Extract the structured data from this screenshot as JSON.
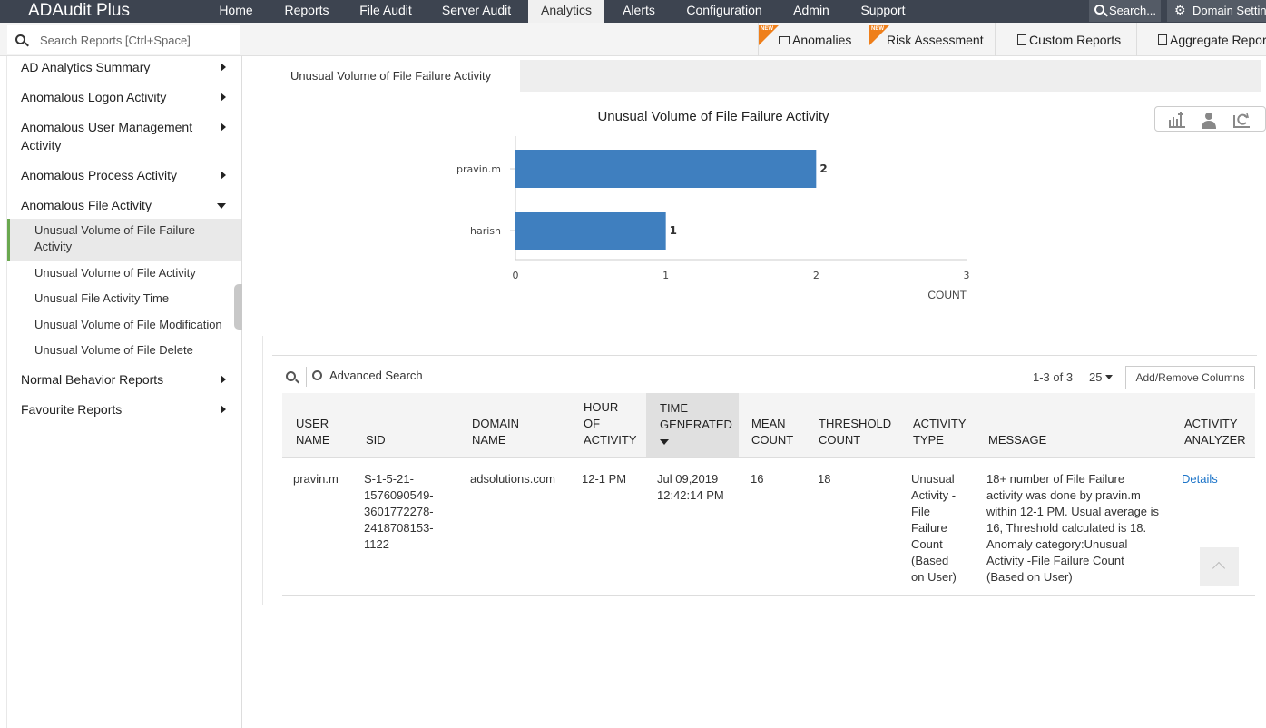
{
  "app": {
    "title": "ADAudit Plus"
  },
  "nav": {
    "items": [
      "Home",
      "Reports",
      "File Audit",
      "Server Audit",
      "Analytics",
      "Alerts",
      "Configuration",
      "Admin",
      "Support"
    ],
    "active": "Analytics",
    "search_label": "Search...",
    "domain_label": "Domain Settings"
  },
  "subbar": {
    "search_placeholder": "Search Reports [Ctrl+Space]",
    "new_badge": "NEW",
    "anomalies": "Anomalies",
    "risk_assessment": "Risk Assessment",
    "custom_reports": "Custom Reports",
    "aggregate_reports": "Aggregate Reports"
  },
  "sidebar": {
    "categories": [
      {
        "label": "AD Analytics Summary",
        "expanded": false
      },
      {
        "label": "Anomalous Logon Activity",
        "expanded": false
      },
      {
        "label": "Anomalous User Management Activity",
        "expanded": false
      },
      {
        "label": "Anomalous Process Activity",
        "expanded": false
      },
      {
        "label": "Anomalous File Activity",
        "expanded": true
      },
      {
        "label": "Normal Behavior Reports",
        "expanded": false
      },
      {
        "label": "Favourite Reports",
        "expanded": false
      }
    ],
    "sub_items": [
      "Unusual Volume of File Failure Activity",
      "Unusual Volume of File Activity",
      "Unusual File Activity Time",
      "Unusual Volume of File Modification",
      "Unusual Volume of File Delete"
    ],
    "active_sub": "Unusual Volume of File Failure Activity"
  },
  "tab": {
    "label": "Unusual Volume of File Failure Activity"
  },
  "chart_data": {
    "type": "bar",
    "orientation": "horizontal",
    "title": "Unusual Volume of File Failure Activity",
    "categories": [
      "pravin.m",
      "harish"
    ],
    "values": [
      2,
      1
    ],
    "xlabel": "COUNT",
    "xlim": [
      0,
      3
    ],
    "xticks": [
      0,
      1,
      2,
      3
    ],
    "bar_color": "#3f7fbf",
    "data_labels": true,
    "grid": false
  },
  "grid": {
    "advanced_search": "Advanced Search",
    "pagination": "1-3 of 3",
    "page_size": "25",
    "add_remove_columns": "Add/Remove Columns",
    "columns": [
      [
        "USER",
        "NAME"
      ],
      [
        "SID"
      ],
      [
        "DOMAIN",
        "NAME"
      ],
      [
        "HOUR",
        "OF",
        "ACTIVITY"
      ],
      [
        "TIME",
        "GENERATED"
      ],
      [
        "MEAN",
        "COUNT"
      ],
      [
        "THRESHOLD",
        "COUNT"
      ],
      [
        "ACTIVITY",
        "TYPE"
      ],
      [
        "MESSAGE"
      ],
      [
        "ACTIVITY",
        "ANALYZER"
      ]
    ],
    "rows": [
      {
        "user": "pravin.m",
        "sid": [
          "S-1-5-21-",
          "1576090549-",
          "3601772278-",
          "2418708153-",
          "1122"
        ],
        "domain": "adsolutions.com",
        "hour": "12-1 PM",
        "time": [
          "Jul 09,2019",
          "12:42:14 PM"
        ],
        "mean": "16",
        "threshold": "18",
        "activity_type": [
          "Unusual",
          "Activity -",
          "File",
          "Failure",
          "Count",
          "(Based",
          "on User)"
        ],
        "message": [
          "18+ number of File Failure",
          "activity was done by pravin.m",
          "within 12-1 PM. Usual average is",
          "16, Threshold calculated is 18.",
          "Anomaly category:Unusual",
          "Activity -File Failure Count",
          "(Based on User)"
        ],
        "analyzer": "Details"
      }
    ]
  }
}
